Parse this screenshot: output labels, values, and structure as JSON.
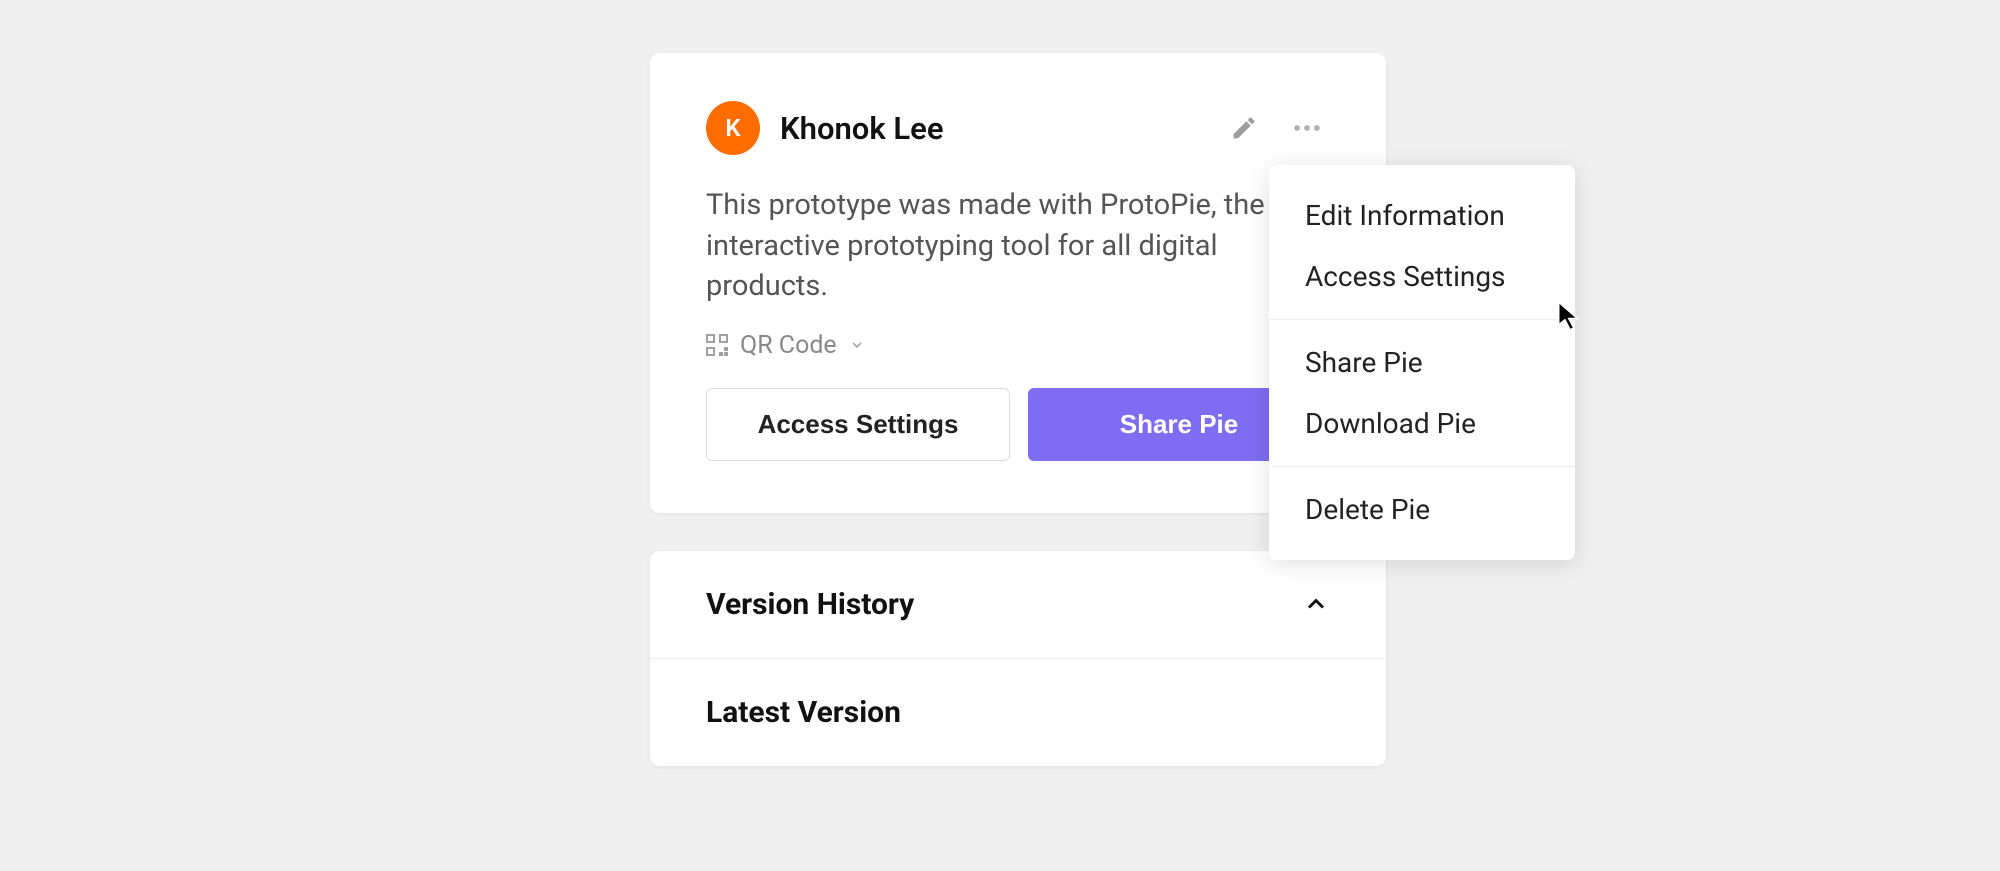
{
  "colors": {
    "accent": "#7e6cf2",
    "avatar_bg": "#ff6d00"
  },
  "card": {
    "author_initial": "K",
    "author_name": "Khonok Lee",
    "description": "This prototype was made with ProtoPie, the interactive prototyping tool for all digital products.",
    "qr_label": "QR Code",
    "access_button": "Access Settings",
    "share_button": "Share Pie"
  },
  "sections": {
    "version_history": "Version History",
    "latest_version": "Latest Version"
  },
  "menu": {
    "edit_info": "Edit Information",
    "access_settings": "Access Settings",
    "share_pie": "Share Pie",
    "download_pie": "Download Pie",
    "delete_pie": "Delete Pie"
  }
}
